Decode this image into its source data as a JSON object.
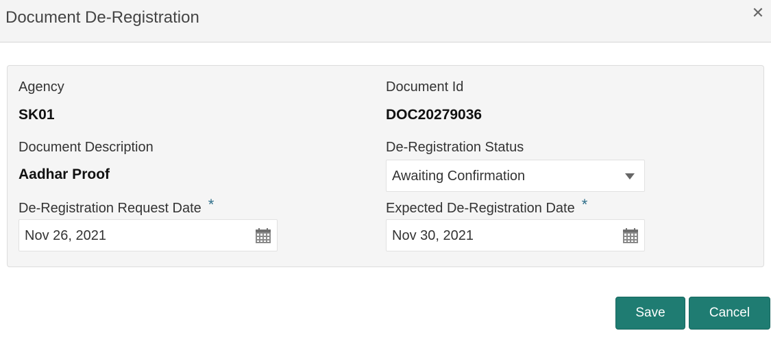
{
  "dialog": {
    "title": "Document De-Registration",
    "close_icon": "close-icon"
  },
  "fields": {
    "agency": {
      "label": "Agency",
      "value": "SK01"
    },
    "document_id": {
      "label": "Document Id",
      "value": "DOC20279036"
    },
    "document_description": {
      "label": "Document Description",
      "value": "Aadhar Proof"
    },
    "deregistration_status": {
      "label": "De-Registration Status",
      "value": "Awaiting Confirmation"
    },
    "request_date": {
      "label": "De-Registration Request Date",
      "required_mark": "*",
      "value": "Nov 26, 2021"
    },
    "expected_date": {
      "label": "Expected De-Registration Date",
      "required_mark": "*",
      "value": "Nov 30, 2021"
    }
  },
  "actions": {
    "save_label": "Save",
    "cancel_label": "Cancel"
  },
  "colors": {
    "accent": "#1f7c72",
    "required": "#2f6f8a",
    "panel_bg": "#f5f5f5",
    "header_bg": "#f4f4f4"
  }
}
